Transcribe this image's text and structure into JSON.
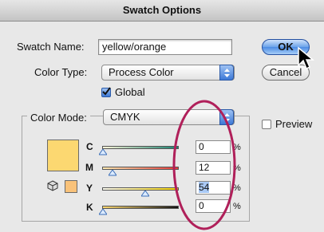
{
  "window": {
    "title": "Swatch Options"
  },
  "swatch_name": {
    "label": "Swatch Name:",
    "value": "yellow/orange"
  },
  "color_type": {
    "label": "Color Type:",
    "value": "Process Color"
  },
  "global": {
    "label": "Global",
    "checked": true
  },
  "color_mode": {
    "label": "Color Mode:",
    "value": "CMYK"
  },
  "buttons": {
    "ok": "OK",
    "cancel": "Cancel"
  },
  "preview": {
    "label": "Preview",
    "checked": false
  },
  "swatch_color": "#fcd871",
  "sliders": [
    {
      "channel": "C",
      "value": "0",
      "unit": "%",
      "gradient": [
        "#fcf6d8",
        "#19806e"
      ]
    },
    {
      "channel": "M",
      "value": "12",
      "unit": "%",
      "gradient": [
        "#fbe9b0",
        "#e23a3a"
      ]
    },
    {
      "channel": "Y",
      "value": "54",
      "unit": "%",
      "gradient": [
        "#fdfcf2",
        "#f6d400"
      ]
    },
    {
      "channel": "K",
      "value": "0",
      "unit": "%",
      "gradient": [
        "#fcd871",
        "#111111"
      ]
    }
  ],
  "icons": [
    "out-of-gamut-cube-icon",
    "web-safe-swatch-icon",
    "mouse-cursor-icon"
  ],
  "annotation_color": "#b0205a"
}
